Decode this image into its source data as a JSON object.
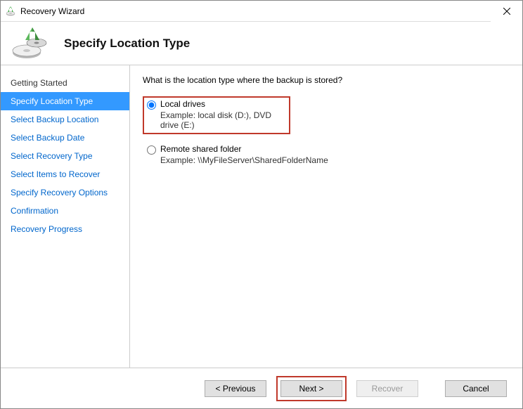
{
  "window": {
    "title": "Recovery Wizard"
  },
  "header": {
    "page_title": "Specify Location Type"
  },
  "sidebar": {
    "steps": [
      "Getting Started",
      "Specify Location Type",
      "Select Backup Location",
      "Select Backup Date",
      "Select Recovery Type",
      "Select Items to Recover",
      "Specify Recovery Options",
      "Confirmation",
      "Recovery Progress"
    ]
  },
  "content": {
    "question": "What is the location type where the backup is stored?",
    "option1": {
      "label": "Local drives",
      "example": "Example: local disk (D:), DVD drive (E:)"
    },
    "option2": {
      "label": "Remote shared folder",
      "example": "Example: \\\\MyFileServer\\SharedFolderName"
    }
  },
  "footer": {
    "previous": "< Previous",
    "next": "Next >",
    "recover": "Recover",
    "cancel": "Cancel"
  }
}
